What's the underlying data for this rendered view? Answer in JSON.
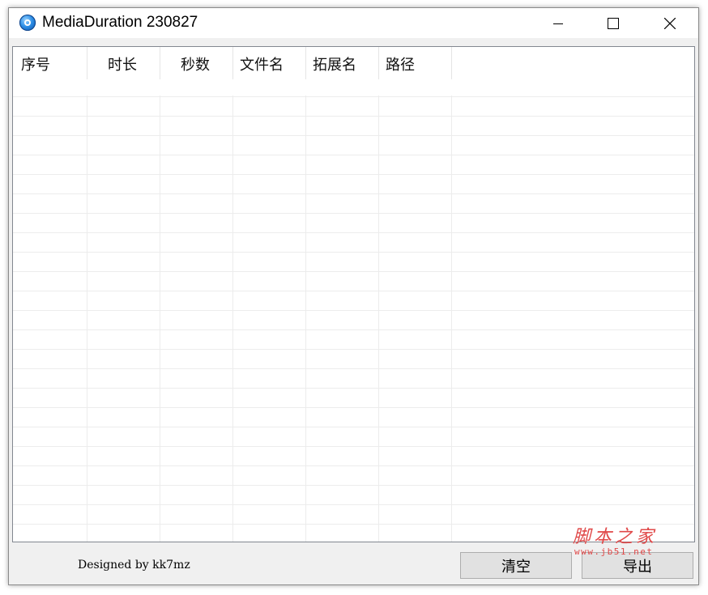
{
  "window": {
    "title": "MediaDuration 230827"
  },
  "titlebar": {
    "icons": {
      "app": "app-disc-icon",
      "minimize": "minimize-icon",
      "maximize": "maximize-icon",
      "close": "close-icon"
    }
  },
  "table": {
    "columns": [
      {
        "label": "序号"
      },
      {
        "label": "时长"
      },
      {
        "label": "秒数"
      },
      {
        "label": "文件名"
      },
      {
        "label": "拓展名"
      },
      {
        "label": "路径"
      }
    ],
    "rows": []
  },
  "footer": {
    "credit": "Designed by kk7mz",
    "clear_label": "清空",
    "export_label": "导出"
  },
  "watermark": {
    "line1": "脚本之家",
    "line2": "www.jb51.net"
  },
  "colors": {
    "accent": "#2d8ee6",
    "watermark": "#e04848"
  }
}
